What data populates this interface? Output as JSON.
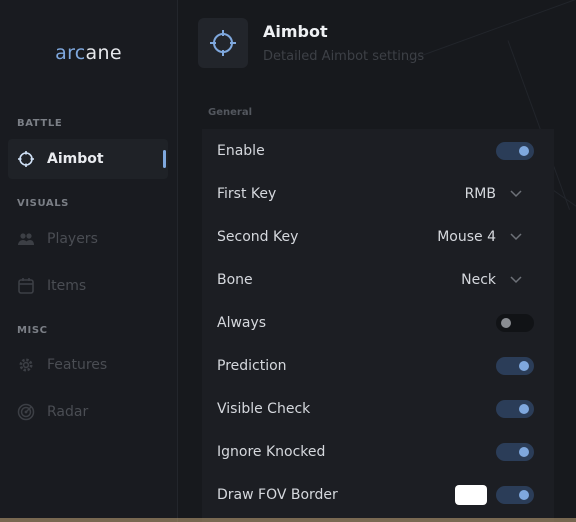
{
  "app": {
    "logo_accent": "arc",
    "logo_rest": "ane"
  },
  "colors": {
    "accent": "#7fa8de",
    "background": "#16181c",
    "panel": "#1c1e23"
  },
  "sidebar": {
    "sections": [
      {
        "title": "BATTLE",
        "items": [
          {
            "label": "Aimbot",
            "icon": "crosshair-icon",
            "active": true
          }
        ]
      },
      {
        "title": "VISUALS",
        "items": [
          {
            "label": "Players",
            "icon": "players-icon",
            "active": false
          },
          {
            "label": "Items",
            "icon": "items-icon",
            "active": false
          }
        ]
      },
      {
        "title": "MISC",
        "items": [
          {
            "label": "Features",
            "icon": "gear-icon",
            "active": false
          },
          {
            "label": "Radar",
            "icon": "radar-icon",
            "active": false
          }
        ]
      }
    ]
  },
  "header": {
    "title": "Aimbot",
    "subtitle": "Detailed Aimbot settings",
    "icon": "crosshair-icon"
  },
  "settings": {
    "group_label": "General",
    "rows": [
      {
        "label": "Enable",
        "type": "toggle",
        "on": true
      },
      {
        "label": "First Key",
        "type": "select",
        "value": "RMB"
      },
      {
        "label": "Second Key",
        "type": "select",
        "value": "Mouse 4"
      },
      {
        "label": "Bone",
        "type": "select",
        "value": "Neck"
      },
      {
        "label": "Always",
        "type": "toggle",
        "on": false
      },
      {
        "label": "Prediction",
        "type": "toggle",
        "on": true
      },
      {
        "label": "Visible Check",
        "type": "toggle",
        "on": true
      },
      {
        "label": "Ignore Knocked",
        "type": "toggle",
        "on": true
      },
      {
        "label": "Draw FOV Border",
        "type": "toggle",
        "on": true,
        "color": "#ffffff"
      }
    ]
  }
}
